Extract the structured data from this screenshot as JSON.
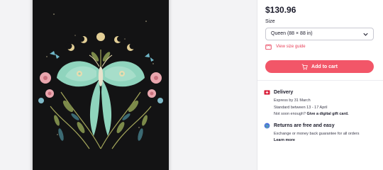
{
  "product": {
    "price": "$130.96",
    "size_label": "Size",
    "size_value": "Queen (88 × 88 in)",
    "size_guide_label": "View size guide",
    "add_to_cart_label": "Add to cart"
  },
  "delivery": {
    "title": "Delivery",
    "express": "Express by 31 March",
    "standard": "Standard between 13 - 17 April",
    "gift_prefix": "Not soon enough?",
    "gift_link": "Give a digital gift card."
  },
  "returns": {
    "title": "Returns are free and easy",
    "text": "Exchange or money back guarantee for all orders",
    "learn_more": "Learn more"
  },
  "icons": {
    "size_chevron": "chevron-down-icon",
    "size_guide": "ruler-icon",
    "cart": "cart-icon",
    "delivery": "delivery-flag-icon",
    "returns": "globe-icon"
  },
  "colors": {
    "accent": "#f25668",
    "link": "#e8415a",
    "duvet": "#131314",
    "moth": "#8fd4bd"
  }
}
